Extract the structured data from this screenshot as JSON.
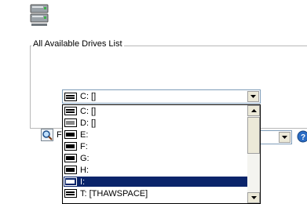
{
  "group": {
    "title": "All Available Drives List"
  },
  "combo": {
    "selected": "C: []"
  },
  "dropdown": {
    "items": [
      {
        "label": "C: []"
      },
      {
        "label": "D: []"
      },
      {
        "label": "E:"
      },
      {
        "label": "F:"
      },
      {
        "label": "G:"
      },
      {
        "label": "H:"
      },
      {
        "label": "I:"
      },
      {
        "label": "T: [THAWSPACE]"
      }
    ],
    "selected_label": "I:"
  },
  "lower_row": {
    "partial_label": "F"
  },
  "colors": {
    "selection": "#0a246a",
    "groupbox_border": "#b8b8b8",
    "combo_border": "#7f9db9"
  },
  "icons": [
    "server-icon",
    "drive-icon",
    "search-icon",
    "help-icon",
    "chevron-down-icon",
    "chevron-up-icon"
  ]
}
